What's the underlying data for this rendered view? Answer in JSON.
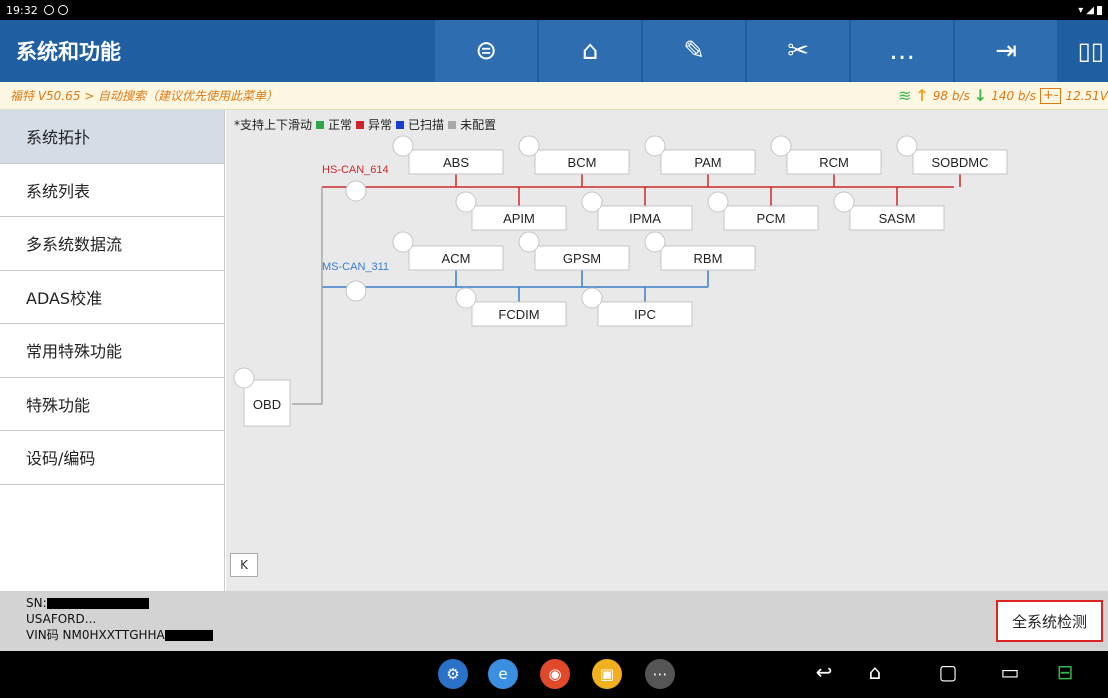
{
  "statusbar": {
    "time": "19:32"
  },
  "header": {
    "title": "系统和功能",
    "toolbar": [
      {
        "name": "vehicle-logo-icon",
        "glyph": "⊜"
      },
      {
        "name": "home-icon",
        "glyph": "⌂"
      },
      {
        "name": "edit-icon",
        "glyph": "✎"
      },
      {
        "name": "tools-icon",
        "glyph": "✂"
      },
      {
        "name": "chat-icon",
        "glyph": "…"
      },
      {
        "name": "exit-icon",
        "glyph": "⇥"
      }
    ],
    "split_icon": "▯▯"
  },
  "crumb": {
    "text": "福特 V50.65 > 自动搜索（建议优先使用此菜单）",
    "up": "98 b/s",
    "down": "140 b/s",
    "voltage": "12.51V"
  },
  "sidebar": {
    "items": [
      {
        "label": "系统拓扑",
        "active": true
      },
      {
        "label": "系统列表",
        "active": false
      },
      {
        "label": "多系统数据流",
        "active": false
      },
      {
        "label": "ADAS校准",
        "active": false
      },
      {
        "label": "常用特殊功能",
        "active": false
      },
      {
        "label": "特殊功能",
        "active": false
      },
      {
        "label": "设码/编码",
        "active": false
      }
    ]
  },
  "legend": {
    "prefix": "*支持上下滑动",
    "items": [
      {
        "label": "正常",
        "color": "#2aa84a"
      },
      {
        "label": "异常",
        "color": "#d0222a"
      },
      {
        "label": "已扫描",
        "color": "#1a3fd0"
      },
      {
        "label": "未配置",
        "color": "#a8a8a8"
      }
    ]
  },
  "topology": {
    "buses": [
      {
        "label": "HS-CAN_614",
        "color": "#cc2a2a",
        "top_row": [
          "ABS",
          "BCM",
          "PAM",
          "RCM",
          "SOBDMC"
        ],
        "bottom_row": [
          "APIM",
          "IPMA",
          "PCM",
          "SASM"
        ]
      },
      {
        "label": "MS-CAN_311",
        "color": "#3a7ec8",
        "top_row": [
          "ACM",
          "GPSM",
          "RBM"
        ],
        "bottom_row": [
          "FCDIM",
          "IPC"
        ]
      }
    ],
    "root": "OBD"
  },
  "collapse_label": "K",
  "info": {
    "sn_label": "SN:",
    "model": "USAFORD...",
    "vin_label": "VIN码 NM0HXXTTGHHA"
  },
  "scan_button": "全系统检测",
  "navbar": {
    "apps": [
      {
        "name": "settings-app-icon",
        "color": "#2a72c8",
        "glyph": "⚙"
      },
      {
        "name": "browser-app-icon",
        "color": "#3a8fe0",
        "glyph": "e"
      },
      {
        "name": "chrome-app-icon",
        "color": "#e04a2a",
        "glyph": "◉"
      },
      {
        "name": "recorder-app-icon",
        "color": "#f0b020",
        "glyph": "▣"
      },
      {
        "name": "app-drawer-icon",
        "color": "#555",
        "glyph": "⋯"
      }
    ],
    "controls": [
      {
        "name": "back-icon",
        "glyph": "↩"
      },
      {
        "name": "home-nav-icon",
        "glyph": "⌂"
      },
      {
        "name": "recents-icon",
        "glyph": "▢"
      },
      {
        "name": "gallery-icon",
        "glyph": "▭"
      },
      {
        "name": "vci-icon",
        "glyph": "⊟"
      }
    ]
  }
}
